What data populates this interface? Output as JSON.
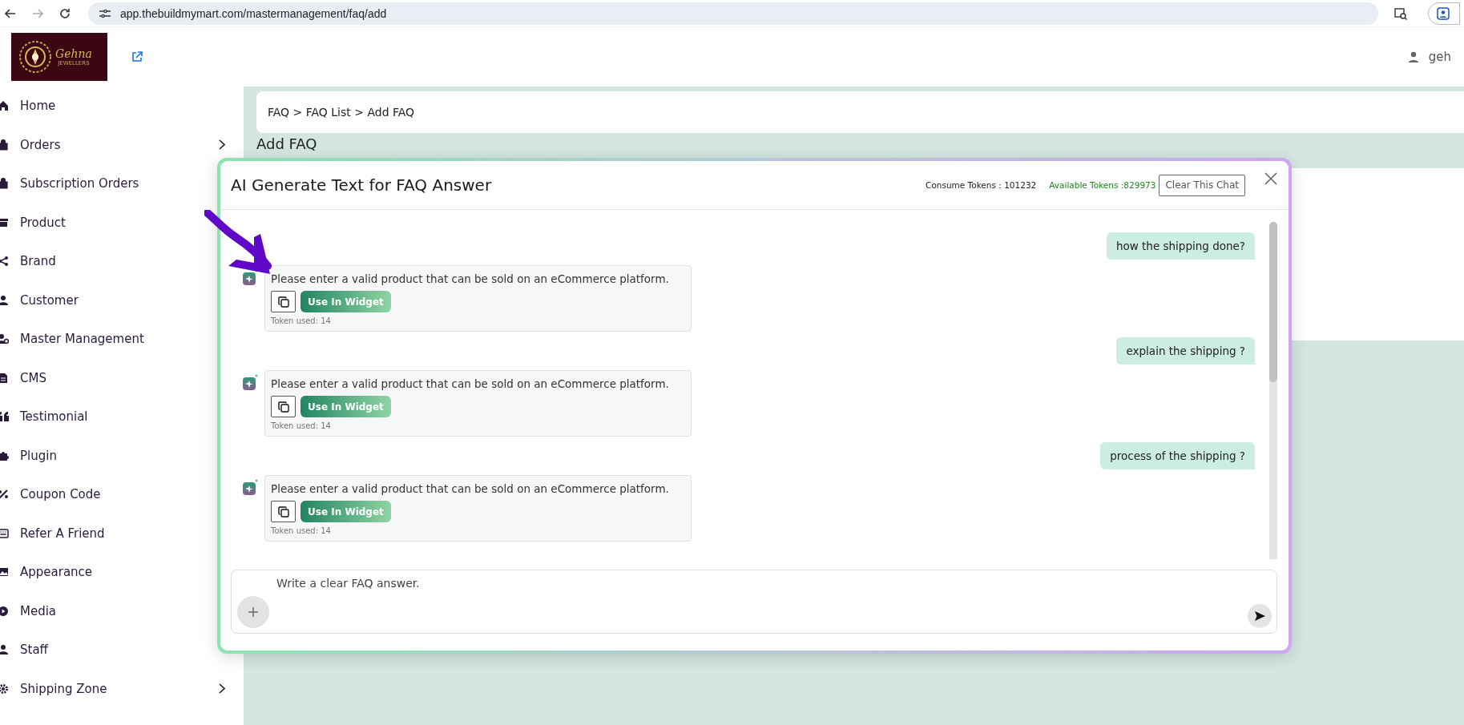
{
  "browser": {
    "url": "app.thebuildmymart.com/mastermanagement/faq/add"
  },
  "logo": {
    "name": "Gehna",
    "tagline": "JEWELLERS"
  },
  "header": {
    "user": "geh"
  },
  "sidebar": {
    "items": [
      {
        "label": "Home",
        "expandable": false
      },
      {
        "label": "Orders",
        "expandable": true
      },
      {
        "label": "Subscription Orders",
        "expandable": false
      },
      {
        "label": "Product",
        "expandable": false
      },
      {
        "label": "Brand",
        "expandable": false
      },
      {
        "label": "Customer",
        "expandable": false
      },
      {
        "label": "Master Management",
        "expandable": false
      },
      {
        "label": "CMS",
        "expandable": false
      },
      {
        "label": "Testimonial",
        "expandable": false
      },
      {
        "label": "Plugin",
        "expandable": false
      },
      {
        "label": "Coupon Code",
        "expandable": false
      },
      {
        "label": "Refer A Friend",
        "expandable": false
      },
      {
        "label": "Appearance",
        "expandable": false
      },
      {
        "label": "Media",
        "expandable": false
      },
      {
        "label": "Staff",
        "expandable": false
      },
      {
        "label": "Shipping Zone",
        "expandable": true
      }
    ]
  },
  "breadcrumb": "FAQ > FAQ List > Add FAQ",
  "page_title": "Add FAQ",
  "modal": {
    "title": "AI Generate Text for FAQ Answer",
    "consume_tokens": "Consume Tokens : 101232",
    "available_tokens": "Available Tokens :829973",
    "clear_button": "Clear This Chat",
    "messages": [
      {
        "kind": "user",
        "text": "how the shipping done?"
      },
      {
        "kind": "bot",
        "text": "Please enter a valid product that can be sold on an eCommerce platform.",
        "action": "Use In Widget",
        "tokens": "Token used: 14"
      },
      {
        "kind": "user",
        "text": "explain the shipping ?"
      },
      {
        "kind": "bot",
        "text": "Please enter a valid product that can be sold on an eCommerce platform.",
        "action": "Use In Widget",
        "tokens": "Token used: 14"
      },
      {
        "kind": "user",
        "text": "process of the shipping ?"
      },
      {
        "kind": "bot",
        "text": "Please enter a valid product that can be sold on an eCommerce platform.",
        "action": "Use In Widget",
        "tokens": "Token used: 14"
      }
    ],
    "input": {
      "placeholder": "Write a clear FAQ answer."
    }
  }
}
